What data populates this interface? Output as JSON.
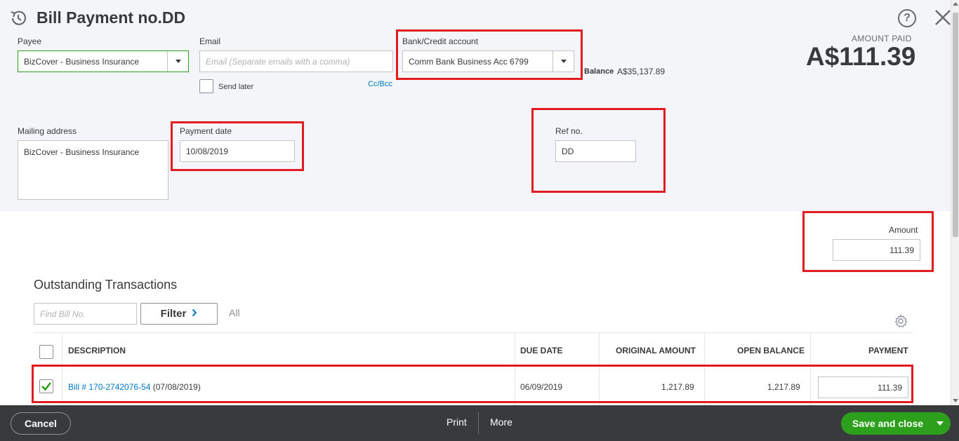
{
  "header": {
    "title": "Bill Payment no.DD",
    "help_icon_glyph": "?"
  },
  "form": {
    "payee": {
      "label": "Payee",
      "value": "BizCover - Business Insurance"
    },
    "email": {
      "label": "Email",
      "placeholder": "Email (Separate emails with a comma)"
    },
    "send_later": {
      "label": "Send later",
      "checked": false
    },
    "cc_bcc": "Cc/Bcc",
    "bank_account": {
      "label": "Bank/Credit account",
      "value": "Comm Bank Business Acc 6799"
    },
    "balance": {
      "label": "Balance",
      "value": "A$35,137.89"
    },
    "amount_paid": {
      "label": "AMOUNT PAID",
      "value": "A$111.39"
    },
    "mailing_address": {
      "label": "Mailing address",
      "value": "BizCover - Business Insurance"
    },
    "payment_date": {
      "label": "Payment date",
      "value": "10/08/2019"
    },
    "ref_no": {
      "label": "Ref no.",
      "value": "DD"
    },
    "amount": {
      "label": "Amount",
      "value": "111.39"
    }
  },
  "outstanding": {
    "title": "Outstanding Transactions",
    "find_placeholder": "Find Bill No.",
    "filter_label": "Filter",
    "filter_status": "All",
    "columns": [
      "DESCRIPTION",
      "DUE DATE",
      "ORIGINAL AMOUNT",
      "OPEN BALANCE",
      "PAYMENT"
    ],
    "rows": [
      {
        "checked": true,
        "bill_link": "Bill # 170-2742076-54",
        "bill_date": "(07/08/2019)",
        "due_date": "06/09/2019",
        "original_amount": "1,217.89",
        "open_balance": "1,217.89",
        "payment": "111.39"
      }
    ]
  },
  "footer": {
    "cancel": "Cancel",
    "print": "Print",
    "more": "More",
    "save_and_close": "Save and close"
  },
  "colors": {
    "highlight_box": "#e11b22",
    "save_button": "#2ca01c",
    "link": "#0077c5",
    "footer_bg": "#393a3d"
  },
  "icons": [
    "history-icon",
    "help-icon",
    "close-icon",
    "chevron-down-icon",
    "chevron-right-icon",
    "gear-icon",
    "checkmark-icon"
  ]
}
